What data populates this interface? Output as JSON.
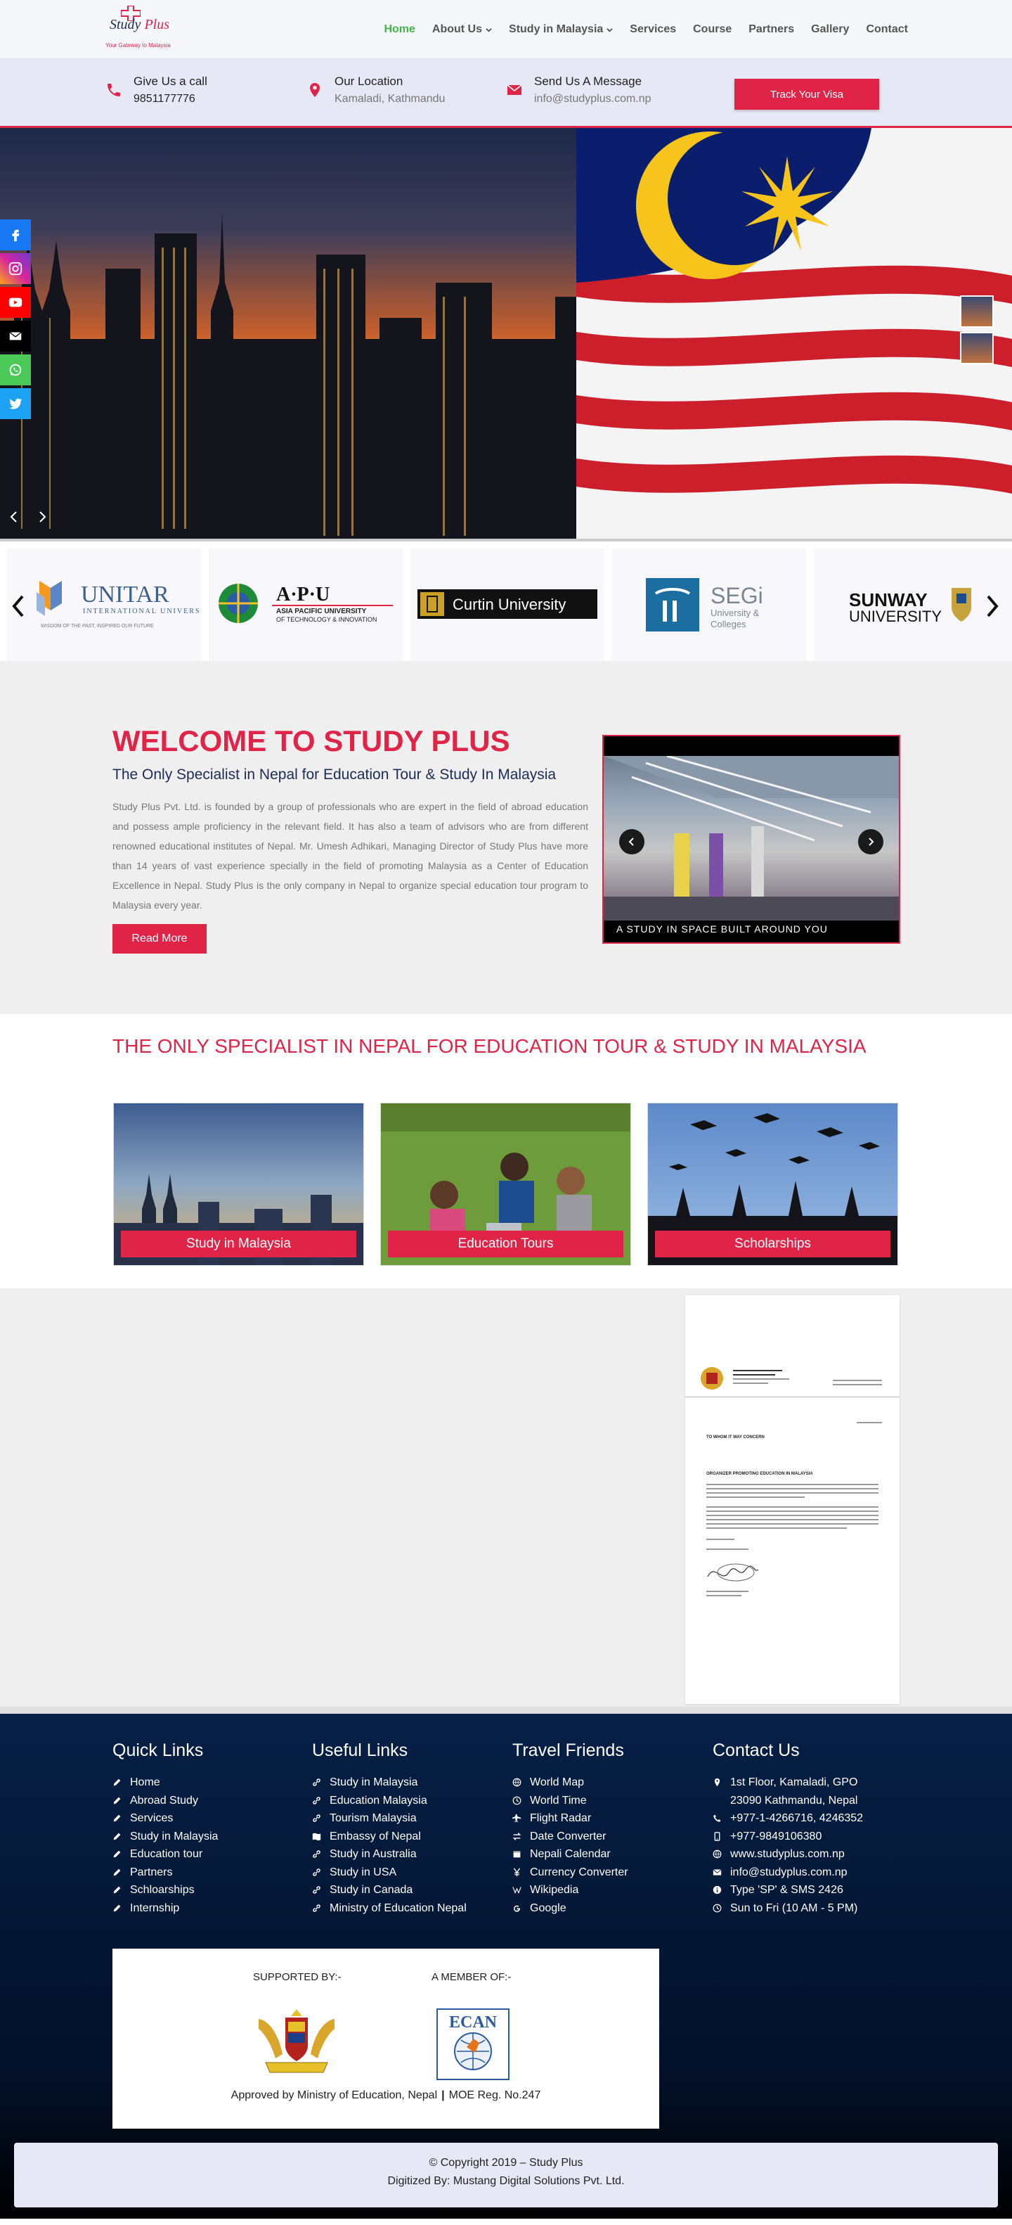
{
  "brand": {
    "name_part1": "Study",
    "name_part2": "Plus",
    "tagline": "Your Gateway to Malaysia"
  },
  "nav": {
    "items": [
      {
        "label": "Home",
        "active": true,
        "dropdown": false
      },
      {
        "label": "About Us",
        "active": false,
        "dropdown": true
      },
      {
        "label": "Study in Malaysia",
        "active": false,
        "dropdown": true
      },
      {
        "label": "Services",
        "active": false,
        "dropdown": false
      },
      {
        "label": "Course",
        "active": false,
        "dropdown": false
      },
      {
        "label": "Partners",
        "active": false,
        "dropdown": false
      },
      {
        "label": "Gallery",
        "active": false,
        "dropdown": false
      },
      {
        "label": "Contact",
        "active": false,
        "dropdown": false
      }
    ]
  },
  "contact_bar": {
    "call": {
      "title": "Give Us a call",
      "value": "9851177776",
      "icon": "phone-icon"
    },
    "location": {
      "title": "Our Location",
      "value": "Kamaladi, Kathmandu",
      "icon": "map-pin-icon"
    },
    "message": {
      "title": "Send Us A Message",
      "value": "info@studyplus.com.np",
      "icon": "envelope-icon"
    },
    "cta_label": "Track Your Visa"
  },
  "social": [
    "facebook-icon",
    "instagram-icon",
    "youtube-icon",
    "email-icon",
    "whatsapp-icon",
    "twitter-icon"
  ],
  "universities": {
    "unitar": {
      "name": "UNITAR",
      "sub": "INTERNATIONAL UNIVERSITY",
      "motto": "WISDOM OF THE PAST, INSPIRED OUR FUTURE"
    },
    "apu": {
      "name": "A·P·U",
      "sub1": "ASIA PACIFIC UNIVERSITY",
      "sub2": "OF TECHNOLOGY & INNOVATION"
    },
    "curtin": {
      "name": "Curtin University"
    },
    "segi": {
      "name": "SEGi",
      "sub1": "University &",
      "sub2": "Colleges"
    },
    "sunway": {
      "name": "SUNWAY",
      "sub": "UNIVERSITY"
    }
  },
  "welcome": {
    "title": "WELCOME TO STUDY PLUS",
    "subtitle": "The Only Specialist in Nepal for Education Tour & Study In Malaysia",
    "body": "Study Plus Pvt. Ltd. is founded by a group of professionals who are expert in the field of abroad education and possess ample proficiency in the relevant field. It has also a team of advisors who are from different renowned educational institutes of Nepal. Mr. Umesh Adhikari, Managing Director of Study Plus have more than 14 years of vast experience specially in the field of promoting Malaysia as a Center of Education Excellence in Nepal. Study Plus is the only company in Nepal to organize special education tour program to Malaysia every year.",
    "button": "Read More",
    "slide_caption": "A STUDY IN SPACE BUILT AROUND YOU"
  },
  "services": {
    "heading": "THE ONLY SPECIALIST IN NEPAL FOR EDUCATION TOUR & STUDY IN MALAYSIA",
    "cards": [
      {
        "label": "Study in Malaysia"
      },
      {
        "label": "Education Tours"
      },
      {
        "label": "Scholarships"
      }
    ]
  },
  "letter": {
    "heading": "TO WHOM IT MAY CONCERN",
    "subject": "ORGANIZER PROMOTING EDUCATION IN MALAYSIA"
  },
  "footer": {
    "quick_links": {
      "title": "Quick Links",
      "items": [
        "Home",
        "Abroad Study",
        "Services",
        "Study in Malaysia",
        "Education tour",
        "Partners",
        "Schloarships",
        "Internship"
      ]
    },
    "useful_links": {
      "title": "Useful Links",
      "items": [
        "Study in Malaysia",
        "Education Malaysia",
        "Tourism Malaysia",
        "Embassy of Nepal",
        "Study in Australia",
        "Study in USA",
        "Study in Canada",
        "Ministry of Education Nepal"
      ]
    },
    "travel_friends": {
      "title": "Travel Friends",
      "items": [
        {
          "label": "World Map",
          "icon": "globe-icon"
        },
        {
          "label": "World Time",
          "icon": "clock-icon"
        },
        {
          "label": "Flight Radar",
          "icon": "plane-icon"
        },
        {
          "label": "Date Converter",
          "icon": "exchange-icon"
        },
        {
          "label": "Nepali Calendar",
          "icon": "calendar-icon"
        },
        {
          "label": "Currency Converter",
          "icon": "yen-icon"
        },
        {
          "label": "Wikipedia",
          "icon": "wikipedia-icon"
        },
        {
          "label": "Google",
          "icon": "google-icon"
        }
      ]
    },
    "contact": {
      "title": "Contact Us",
      "items": [
        {
          "label": "1st Floor, Kamaladi, GPO 23090 Kathmandu, Nepal",
          "icon": "map-marker-icon"
        },
        {
          "label": "+977-1-4266716, 4246352",
          "icon": "phone-icon"
        },
        {
          "label": "+977-9849106380",
          "icon": "mobile-icon"
        },
        {
          "label": "www.studyplus.com.np",
          "icon": "globe-icon"
        },
        {
          "label": "info@studyplus.com.np",
          "icon": "envelope-icon"
        },
        {
          "label": "Type 'SP' & SMS 2426",
          "icon": "info-icon"
        },
        {
          "label": "Sun to Fri (10 AM - 5 PM)",
          "icon": "clock-icon"
        }
      ]
    },
    "supported_by": "SUPPORTED BY:-",
    "member_of": "A MEMBER OF:-",
    "ecan": "ECAN",
    "approved": "Approved by Ministry of Education, Nepal",
    "separator": "|",
    "moe": "MOE Reg. No.247",
    "copyright": "© Copyright 2019 – Study Plus",
    "digitized": "Digitized By: Mustang Digital Solutions Pvt. Ltd."
  },
  "colors": {
    "accent": "#e02447",
    "nav_active": "#45b549",
    "navy": "#1d2c55",
    "footer_bg": "#072046"
  }
}
